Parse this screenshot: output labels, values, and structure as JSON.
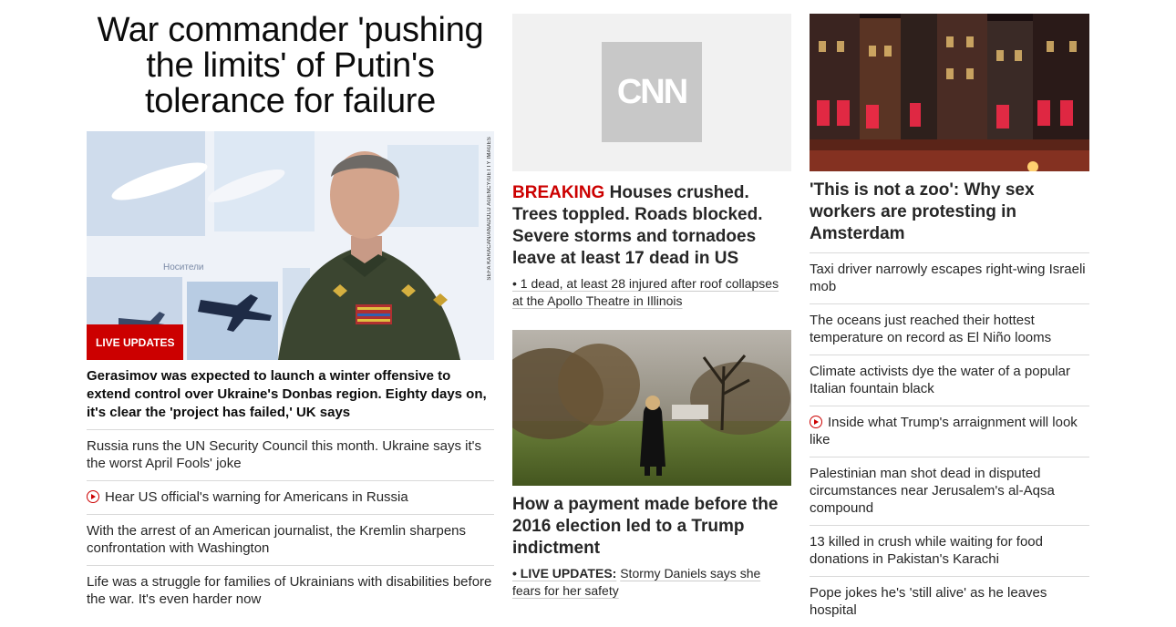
{
  "col1": {
    "headline": "War commander 'pushing the limits' of Putin's tolerance for failure",
    "badge": "LIVE UPDATES",
    "photo_credit": "SEFA KARACAN/ANADOLU AGENCY/GETTY IMAGES",
    "lead": "Gerasimov was expected to launch a winter offensive to extend control over Ukraine's Donbas region. Eighty days on, it's clear the 'project has failed,' UK says",
    "items": [
      {
        "text": "Russia runs the UN Security Council this month. Ukraine says it's the worst April Fools' joke"
      },
      {
        "text": "Hear US official's warning for Americans in Russia"
      },
      {
        "text": "With the arrest of an American journalist, the Kremlin sharpens confrontation with Washington"
      },
      {
        "text": "Life was a struggle for families of Ukrainians with disabilities before the war. It's even harder now"
      }
    ]
  },
  "col2": {
    "logo_text": "CNN",
    "breaking_label": "BREAKING",
    "breaking_head": "Houses crushed. Trees toppled. Roads blocked. Severe storms and tornadoes leave at least 17 dead in US",
    "breaking_sub": "• 1 dead, at least 28 injured after roof collapses at the Apollo Theatre in Illinois",
    "story2_head": "How a payment made before the 2016 election led to a Trump indictment",
    "story2_prefix": "• LIVE UPDATES:",
    "story2_sub": "Stormy Daniels says she fears for her safety"
  },
  "col3": {
    "lead": "'This is not a zoo': Why sex workers are protesting in Amsterdam",
    "items": [
      {
        "text": "Taxi driver narrowly escapes right-wing Israeli mob"
      },
      {
        "text": "The oceans just reached their hottest temperature on record as El Niño looms"
      },
      {
        "text": "Climate activists dye the water of a popular Italian fountain black"
      },
      {
        "text": "Inside what Trump's arraignment will look like"
      },
      {
        "text": "Palestinian man shot dead in disputed circumstances near Jerusalem's al-Aqsa compound"
      },
      {
        "text": "13 killed in crush while waiting for food donations in Pakistan's Karachi"
      },
      {
        "text": "Pope jokes he's 'still alive' as he leaves hospital"
      }
    ]
  },
  "colors": {
    "accent": "#cc0000",
    "text": "#0c0c0c",
    "divider": "#d9d9d9"
  }
}
